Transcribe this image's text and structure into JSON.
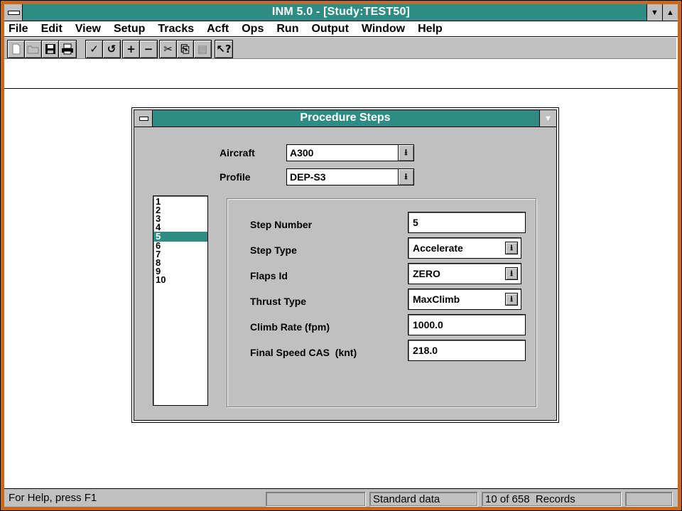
{
  "app": {
    "title": "INM 5.0 - [Study:TEST50]",
    "window_buttons": {
      "min": "▼",
      "max": "▲"
    }
  },
  "menu": [
    {
      "label": "File"
    },
    {
      "label": "Edit"
    },
    {
      "label": "View"
    },
    {
      "label": "Setup"
    },
    {
      "label": "Tracks"
    },
    {
      "label": "Acft"
    },
    {
      "label": "Ops"
    },
    {
      "label": "Run"
    },
    {
      "label": "Output"
    },
    {
      "label": "Window"
    },
    {
      "label": "Help"
    }
  ],
  "toolbar": {
    "file_group": [
      "new-icon",
      "open-icon",
      "save-icon",
      "print-icon"
    ],
    "check": "✓",
    "undo": "↺",
    "add": "+",
    "remove": "−",
    "cut": "✂",
    "copy": "⎘",
    "paste": "▤",
    "help": "↖?"
  },
  "dialog": {
    "title": "Procedure Steps",
    "aircraft_label": "Aircraft",
    "aircraft_value": "A300",
    "profile_label": "Profile",
    "profile_value": "DEP-S3",
    "steps": [
      "1",
      "2",
      "3",
      "4",
      "5",
      "6",
      "7",
      "8",
      "9",
      "10"
    ],
    "selected_step_index": 4,
    "fields": {
      "step_number": {
        "label": "Step Number",
        "value": "5"
      },
      "step_type": {
        "label": "Step Type",
        "value": "Accelerate"
      },
      "flaps_id": {
        "label": "Flaps Id",
        "value": "ZERO"
      },
      "thrust_type": {
        "label": "Thrust Type",
        "value": "MaxClimb"
      },
      "climb_rate": {
        "label": "Climb Rate (fpm)",
        "value": "1000.0"
      },
      "final_speed": {
        "label": "Final Speed CAS  (knt)",
        "value": "218.0"
      }
    }
  },
  "status": {
    "help": "For Help, press F1",
    "data": "Standard data",
    "records": "10 of 658  Records"
  },
  "colors": {
    "title_bar": "#2f8c85",
    "frame": "#c86a1e",
    "face": "#c0c0c0"
  }
}
